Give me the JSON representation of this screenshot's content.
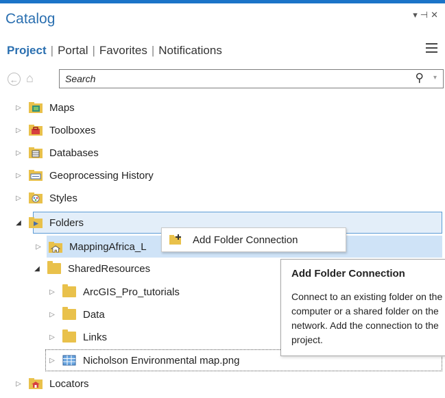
{
  "pane": {
    "title": "Catalog"
  },
  "tabs": [
    {
      "label": "Project",
      "active": true
    },
    {
      "label": "Portal",
      "active": false
    },
    {
      "label": "Favorites",
      "active": false
    },
    {
      "label": "Notifications",
      "active": false
    }
  ],
  "search": {
    "placeholder": "Search"
  },
  "tree": {
    "maps": "Maps",
    "toolboxes": "Toolboxes",
    "databases": "Databases",
    "geoprocessing_history": "Geoprocessing History",
    "styles": "Styles",
    "folders": "Folders",
    "mapping_africa": "MappingAfrica_L",
    "shared_resources": "SharedResources",
    "arcgis_pro_tutorials": "ArcGIS_Pro_tutorials",
    "data": "Data",
    "links": "Links",
    "nicholson_map": "Nicholson Environmental map.png",
    "locators": "Locators"
  },
  "context_menu": {
    "add_folder_connection": "Add Folder Connection"
  },
  "tooltip": {
    "title": "Add Folder Connection",
    "body": "Connect to an existing folder on the local computer or a shared folder on the network. Add the connection to the project."
  },
  "colors": {
    "accent": "#1b74c8",
    "folder": "#e9c14b",
    "selection": "#e3eef9",
    "hover": "#cfe3f7"
  }
}
